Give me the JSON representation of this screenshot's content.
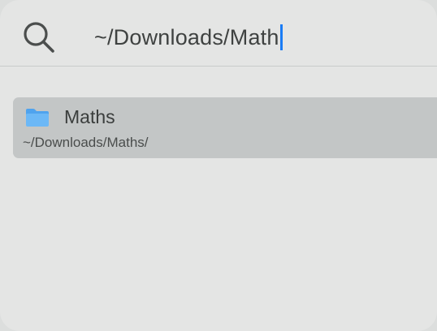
{
  "search": {
    "query": "~/Downloads/Math",
    "icon": "search-icon"
  },
  "results": [
    {
      "title": "Maths",
      "path": "~/Downloads/Maths/",
      "icon": "folder-icon",
      "selected": true
    }
  ],
  "colors": {
    "caret": "#1a7cf5",
    "folder": "#5fb0f4",
    "selection": "#c3c6c6"
  }
}
